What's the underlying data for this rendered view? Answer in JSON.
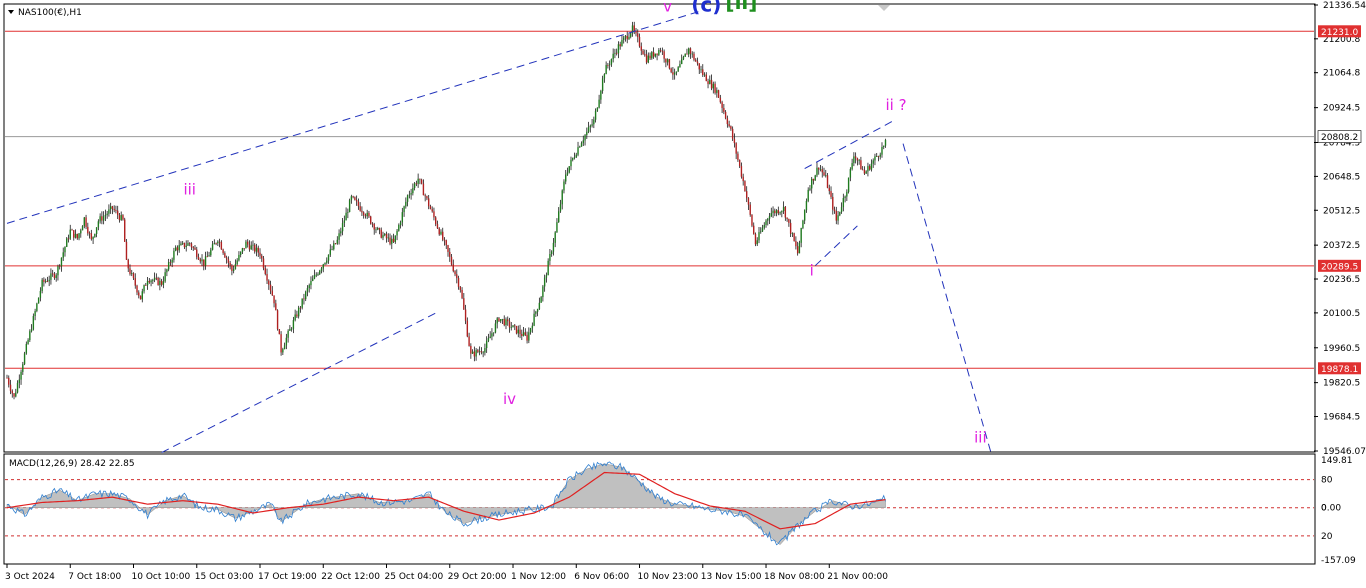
{
  "chart_data": {
    "type": "candlestick",
    "title": "NAS100(€),H1",
    "colors": {
      "up_candle": "#1f7a1f",
      "down_candle": "#b02020",
      "wick": "#1a1a1a",
      "level_lines": "#e03030",
      "channel_lines": "#2233bb",
      "grid_price_line": "#9a9a9a",
      "wave_labels": "#e020e0",
      "macd_histogram": "#c0c0c0",
      "macd_signal": "#e02020",
      "macd_line": "#2f7fd0"
    },
    "price_axis": {
      "ylim": [
        19546.07,
        21336.54
      ],
      "ticks": [
        "21336.54",
        "21200.8",
        "21064.8",
        "20924.5",
        "20784.5",
        "20648.5",
        "20512.5",
        "20372.5",
        "20236.5",
        "20100.5",
        "19960.5",
        "19820.5",
        "19684.5",
        "19546.07"
      ]
    },
    "time_axis": {
      "ticks": [
        "3 Oct 2024",
        "7 Oct 18:00",
        "10 Oct 10:00",
        "15 Oct 03:00",
        "17 Oct 19:00",
        "22 Oct 12:00",
        "25 Oct 04:00",
        "29 Oct 20:00",
        "1 Nov 12:00",
        "6 Nov 06:00",
        "10 Nov 23:00",
        "13 Nov 15:00",
        "18 Nov 08:00",
        "21 Nov 00:00"
      ]
    },
    "horizontal_levels": [
      {
        "value": 21231.0,
        "label": "21231.0",
        "style": "red"
      },
      {
        "value": 20808.2,
        "label": "20808.2",
        "style": "current"
      },
      {
        "value": 20289.5,
        "label": "20289.5",
        "style": "red"
      },
      {
        "value": 19878.1,
        "label": "19878.1",
        "style": "red"
      }
    ],
    "price_path": [
      [
        0,
        19840
      ],
      [
        4,
        19760
      ],
      [
        12,
        19990
      ],
      [
        20,
        20220
      ],
      [
        28,
        20260
      ],
      [
        36,
        20430
      ],
      [
        40,
        20400
      ],
      [
        44,
        20480
      ],
      [
        48,
        20390
      ],
      [
        52,
        20470
      ],
      [
        60,
        20520
      ],
      [
        66,
        20470
      ],
      [
        68,
        20300
      ],
      [
        76,
        20160
      ],
      [
        80,
        20240
      ],
      [
        88,
        20220
      ],
      [
        96,
        20360
      ],
      [
        104,
        20380
      ],
      [
        112,
        20300
      ],
      [
        120,
        20400
      ],
      [
        128,
        20270
      ],
      [
        136,
        20380
      ],
      [
        144,
        20340
      ],
      [
        152,
        20150
      ],
      [
        156,
        19950
      ],
      [
        164,
        20080
      ],
      [
        172,
        20210
      ],
      [
        180,
        20300
      ],
      [
        188,
        20390
      ],
      [
        196,
        20560
      ],
      [
        204,
        20500
      ],
      [
        212,
        20420
      ],
      [
        220,
        20380
      ],
      [
        228,
        20570
      ],
      [
        234,
        20640
      ],
      [
        242,
        20500
      ],
      [
        250,
        20360
      ],
      [
        258,
        20200
      ],
      [
        264,
        19930
      ],
      [
        272,
        19960
      ],
      [
        280,
        20080
      ],
      [
        288,
        20040
      ],
      [
        296,
        20000
      ],
      [
        304,
        20170
      ],
      [
        312,
        20420
      ],
      [
        318,
        20660
      ],
      [
        326,
        20780
      ],
      [
        334,
        20870
      ],
      [
        340,
        21070
      ],
      [
        348,
        21170
      ],
      [
        356,
        21240
      ],
      [
        364,
        21120
      ],
      [
        372,
        21160
      ],
      [
        380,
        21050
      ],
      [
        388,
        21160
      ],
      [
        396,
        21060
      ],
      [
        404,
        20990
      ],
      [
        412,
        20830
      ],
      [
        420,
        20600
      ],
      [
        426,
        20380
      ],
      [
        434,
        20500
      ],
      [
        442,
        20520
      ],
      [
        450,
        20340
      ],
      [
        456,
        20600
      ],
      [
        462,
        20690
      ],
      [
        466,
        20640
      ],
      [
        472,
        20470
      ],
      [
        478,
        20600
      ],
      [
        482,
        20740
      ],
      [
        488,
        20660
      ],
      [
        494,
        20720
      ],
      [
        500,
        20780
      ]
    ],
    "channel_lines": [
      {
        "from": [
          0,
          20460
        ],
        "to": [
          396,
          21315
        ]
      },
      {
        "from": [
          88,
          19540
        ],
        "to": [
          244,
          20100
        ]
      },
      {
        "from": [
          454,
          20680
        ],
        "to": [
          504,
          20870
        ]
      },
      {
        "from": [
          460,
          20290
        ],
        "to": [
          484,
          20450
        ]
      },
      {
        "from": [
          510,
          20780
        ],
        "to": [
          560,
          19540
        ]
      }
    ],
    "wave_labels": [
      {
        "text": "iii",
        "bar": 104,
        "price": 20575,
        "color": "#e020e0",
        "size": "medium"
      },
      {
        "text": "iv",
        "bar": 286,
        "price": 19735,
        "color": "#e020e0",
        "size": "medium"
      },
      {
        "text": "v",
        "bar": 376,
        "price": 21310,
        "color": "#e020e0",
        "size": "medium"
      },
      {
        "text": "(c)",
        "bar": 398,
        "price": 21310,
        "color": "#1f2fcf",
        "size": "large"
      },
      {
        "text": "[ii]",
        "bar": 418,
        "price": 21320,
        "color": "#1f8f1f",
        "size": "large"
      },
      {
        "text": "i",
        "bar": 458,
        "price": 20250,
        "color": "#e020e0",
        "size": "medium"
      },
      {
        "text": "ii ?",
        "bar": 506,
        "price": 20915,
        "color": "#e020e0",
        "size": "medium"
      },
      {
        "text": "iii",
        "bar": 554,
        "price": 19580,
        "color": "#e020e0",
        "size": "medium"
      }
    ],
    "macd": {
      "label": "MACD(12,26,9) 28.42 22.85",
      "ylim": [
        -157.09,
        149.81
      ],
      "ticks": [
        "149.81",
        "80",
        "0.00",
        "0",
        "20",
        "-157.09"
      ],
      "dashed_levels": [
        80,
        0,
        -80
      ],
      "histogram_path": [
        [
          0,
          10
        ],
        [
          10,
          -20
        ],
        [
          20,
          30
        ],
        [
          30,
          50
        ],
        [
          40,
          20
        ],
        [
          50,
          40
        ],
        [
          60,
          40
        ],
        [
          70,
          25
        ],
        [
          80,
          -20
        ],
        [
          90,
          20
        ],
        [
          100,
          35
        ],
        [
          110,
          0
        ],
        [
          120,
          -5
        ],
        [
          130,
          -30
        ],
        [
          140,
          -10
        ],
        [
          150,
          10
        ],
        [
          156,
          -40
        ],
        [
          170,
          10
        ],
        [
          180,
          25
        ],
        [
          200,
          40
        ],
        [
          212,
          15
        ],
        [
          230,
          20
        ],
        [
          240,
          40
        ],
        [
          250,
          -15
        ],
        [
          260,
          -45
        ],
        [
          270,
          -30
        ],
        [
          280,
          -20
        ],
        [
          290,
          -10
        ],
        [
          300,
          -5
        ],
        [
          310,
          5
        ],
        [
          320,
          80
        ],
        [
          330,
          110
        ],
        [
          340,
          125
        ],
        [
          350,
          115
        ],
        [
          360,
          75
        ],
        [
          370,
          30
        ],
        [
          380,
          10
        ],
        [
          390,
          5
        ],
        [
          400,
          -5
        ],
        [
          410,
          -10
        ],
        [
          420,
          -25
        ],
        [
          430,
          -65
        ],
        [
          440,
          -105
        ],
        [
          450,
          -50
        ],
        [
          460,
          -10
        ],
        [
          470,
          20
        ],
        [
          480,
          5
        ],
        [
          490,
          10
        ],
        [
          500,
          25
        ]
      ],
      "signal_path": [
        [
          0,
          0
        ],
        [
          20,
          15
        ],
        [
          40,
          20
        ],
        [
          60,
          30
        ],
        [
          80,
          10
        ],
        [
          100,
          20
        ],
        [
          120,
          10
        ],
        [
          140,
          -15
        ],
        [
          160,
          0
        ],
        [
          180,
          10
        ],
        [
          200,
          30
        ],
        [
          220,
          20
        ],
        [
          240,
          30
        ],
        [
          260,
          -10
        ],
        [
          280,
          -35
        ],
        [
          300,
          -15
        ],
        [
          320,
          30
        ],
        [
          340,
          100
        ],
        [
          360,
          95
        ],
        [
          380,
          40
        ],
        [
          400,
          5
        ],
        [
          420,
          -10
        ],
        [
          440,
          -60
        ],
        [
          460,
          -45
        ],
        [
          480,
          10
        ],
        [
          500,
          22.85
        ]
      ]
    },
    "bars_per_time_tick": 36
  }
}
